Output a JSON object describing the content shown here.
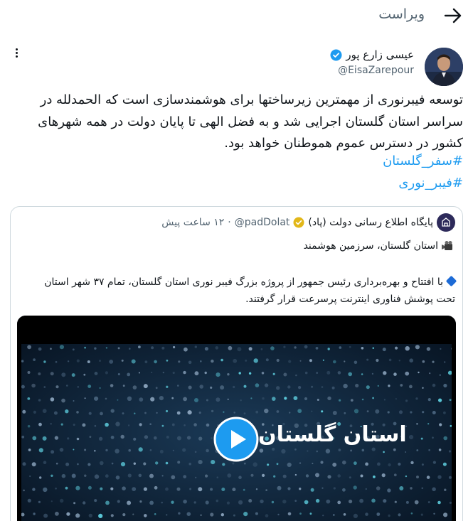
{
  "header": {
    "back_icon": "arrow-right-icon",
    "edit_label": "ویراست"
  },
  "post": {
    "author_name": "عیسی زارع پور",
    "author_handle": "@EisaZarepour",
    "text": "توسعه فیبرنوری از مهمترین زیرساختها برای هوشمندسازی است که الحمدلله در سراسر استان گلستان اجرایی شد و به فضل الهی تا پایان دولت در همه شهرهای کشور در دسترس عموم هموطنان خواهد بود.",
    "hashtags": [
      "#سفر_گلستان",
      "#فیبر_نوری"
    ]
  },
  "quote": {
    "source_name": "پایگاه اطلاع رسانی دولت (پاد)",
    "source_handle": "@padDolat",
    "time": "۱۲ ساعت پیش",
    "separator": "·",
    "line1": "استان گلستان، سرزمین هوشمند",
    "body": "با افتتاح و بهره‌برداری رئیس جمهور از پروژه بزرگ فیبر نوری استان گلستان، تمام ۳۷ شهر استان تحت پوشش فناوری اینترنت پرسرعت قرار گرفتند.",
    "video_title": "استان گلستان"
  },
  "colors": {
    "accent": "#1d9bf0",
    "muted": "#536471",
    "border": "#cfd9de",
    "gold": "#e2b719"
  }
}
